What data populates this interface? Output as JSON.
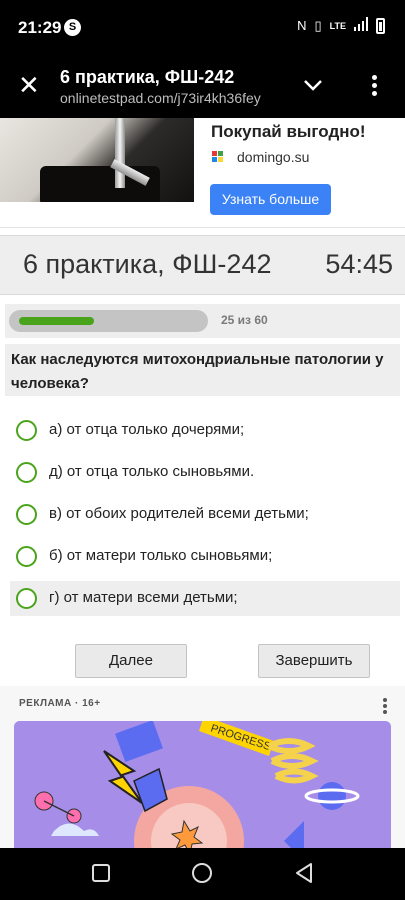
{
  "status_bar": {
    "time": "21:29",
    "app_badge": "S",
    "network": "LTE"
  },
  "browser": {
    "title": "6 практика, ФШ-242",
    "url": "onlinetestpad.com/j73ir4kh36fey"
  },
  "top_ad": {
    "headline": "Покупай выгодно!",
    "domain": "domingo.su",
    "button": "Узнать больше",
    "accent": "#3b82f6"
  },
  "quiz": {
    "title": "6 практика, ФШ-242",
    "timer": "54:45",
    "progress_text": "25 из 60",
    "progress_fraction": 0.42,
    "question": "Как наследуются митохондриальные патологии у человека?",
    "answers": [
      {
        "label": "а) от отца только дочерями;"
      },
      {
        "label": "д) от отца только сыновьями."
      },
      {
        "label": "в) от обоих родителей всеми детьми;"
      },
      {
        "label": "б) от матери только сыновьями;"
      },
      {
        "label": "г) от матери всеми детьми;"
      }
    ],
    "next_button": "Далее",
    "finish_button": "Завершить",
    "accent": "#4aa41b"
  },
  "bottom_ad": {
    "label": "РЕКЛАМА · 16+",
    "art_word": "PROGRESS"
  },
  "nav_icons": [
    "recents-icon",
    "home-icon",
    "back-icon"
  ]
}
